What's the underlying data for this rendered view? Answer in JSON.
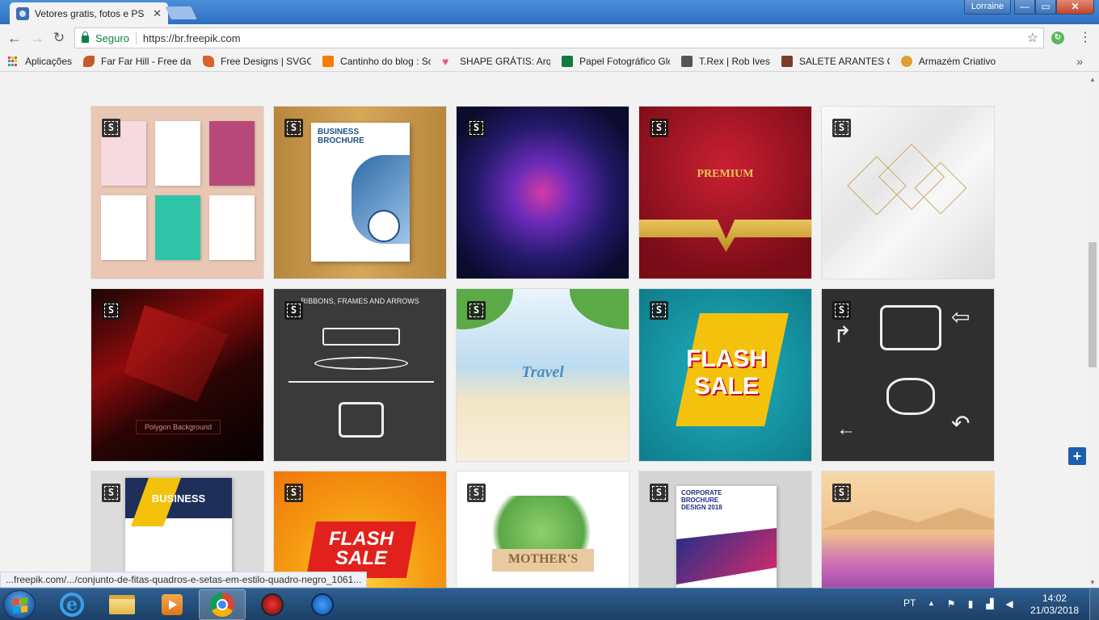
{
  "browser": {
    "tab_title": "Vetores gratis, fotos e PS",
    "tab_close": "✕",
    "user_name": "Lorraine",
    "win_min": "—",
    "win_max": "▭",
    "win_close": "✕",
    "secure_label": "Seguro",
    "url": "https://br.freepik.com",
    "back_glyph": "←",
    "forward_glyph": "→",
    "reload_glyph": "↻",
    "star_glyph": "☆",
    "menu_glyph": "⋮",
    "extension_glyph": "↻",
    "bookmarks_more": "»"
  },
  "bookmarks": [
    {
      "label": "Aplicações",
      "icon": "apps-grid-icon",
      "color": "#e94235"
    },
    {
      "label": "Far Far Hill - Free dat",
      "icon": "far-far-hill-icon",
      "color": "#c45a2c"
    },
    {
      "label": "Free Designs | SVGCu",
      "icon": "svgcuts-icon",
      "color": "#d9622b"
    },
    {
      "label": "Cantinho do blog : Sc",
      "icon": "blogger-icon",
      "color": "#f57d00"
    },
    {
      "label": "SHAPE GRÁTIS: Arqui",
      "icon": "heart-icon",
      "color": "#e8588a"
    },
    {
      "label": "Papel Fotográfico Glc",
      "icon": "sheets-icon",
      "color": "#0f7b3f"
    },
    {
      "label": "T.Rex | Rob Ives",
      "icon": "trex-icon",
      "color": "#555555"
    },
    {
      "label": "SALETE ARANTES CRI",
      "icon": "salete-icon",
      "color": "#7a3d2a"
    },
    {
      "label": "Armazém Criativo",
      "icon": "armazem-icon",
      "color": "#e0a030"
    }
  ],
  "grid": {
    "badge": "S",
    "cards": [
      {
        "name": "floral-cards",
        "label": ""
      },
      {
        "name": "business-brochure",
        "label": "BUSINESS BROCHURE"
      },
      {
        "name": "halftone-dark-background",
        "label": ""
      },
      {
        "name": "premium-red-gold",
        "label": "PREMIUM"
      },
      {
        "name": "marble-geometric",
        "label": ""
      },
      {
        "name": "red-polygon-background",
        "label": "Polygon Background"
      },
      {
        "name": "ribbons-frames-arrows",
        "label": "RIBBONS, FRAMES AND ARROWS"
      },
      {
        "name": "travel-beach",
        "label": "Travel"
      },
      {
        "name": "flash-sale-teal",
        "label": "FLASH SALE"
      },
      {
        "name": "chalkboard-arrows",
        "label": ""
      },
      {
        "name": "business-flyer",
        "label": "BUSINESS"
      },
      {
        "name": "flash-sale-orange",
        "label": "FLASH SALE"
      },
      {
        "name": "mothers-day",
        "label": "MOTHER'S"
      },
      {
        "name": "corporate-brochure",
        "label": "CORPORATE BROCHURE DESIGN 2018"
      },
      {
        "name": "desert-landscape",
        "label": ""
      }
    ]
  },
  "page": {
    "plus_label": "+",
    "status_url": "...freepik.com/.../conjunto-de-fitas-quadros-e-setas-em-estilo-quadro-negro_1061..."
  },
  "taskbar": {
    "language": "PT",
    "time": "14:02",
    "date": "21/03/2018",
    "tray_up": "▲"
  }
}
